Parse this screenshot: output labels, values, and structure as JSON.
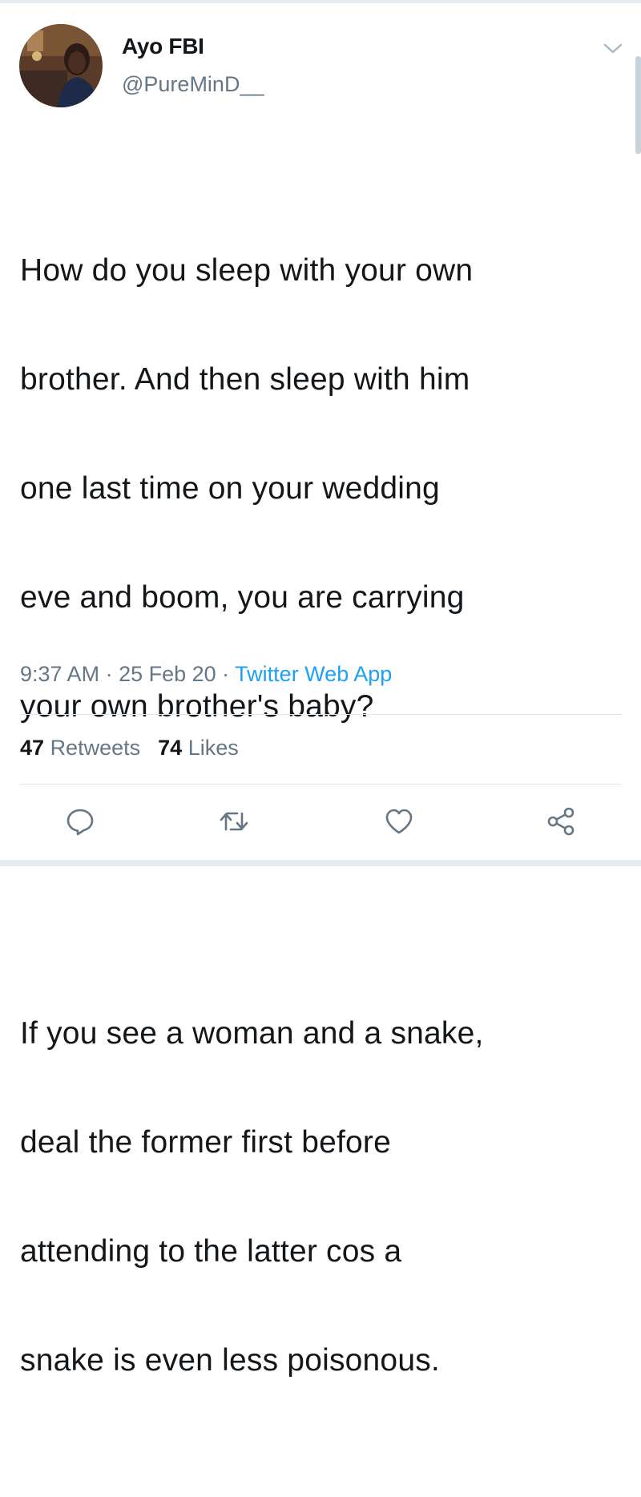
{
  "author": {
    "display_name": "Ayo FBI",
    "handle": "@PureMinD__"
  },
  "tweet": {
    "paragraphs": [
      "How do you sleep with your own brother. And then sleep with him one last time on your wedding eve and boom, you are carrying your own brother's baby?",
      "If you see a woman and a snake, deal the former first before attending to the latter cos a snake is even less poisonous."
    ],
    "lines_p1": [
      "How do you sleep with your own",
      "brother. And then sleep with him",
      "one last time on your wedding",
      "eve and boom, you are carrying",
      "your own brother's baby?"
    ],
    "lines_p2": [
      "If you see a woman and a snake,",
      "deal the former first before",
      "attending to the latter cos a",
      "snake is even less poisonous."
    ]
  },
  "meta": {
    "time": "9:37 AM",
    "separator": " · ",
    "date": "25 Feb 20",
    "app": "Twitter Web App"
  },
  "stats": {
    "retweets_count": "47",
    "retweets_label": "Retweets",
    "likes_count": "74",
    "likes_label": "Likes"
  },
  "actions": {
    "reply_icon": "reply-icon",
    "retweet_icon": "retweet-icon",
    "like_icon": "heart-icon",
    "share_icon": "share-icon"
  },
  "colors": {
    "text_primary": "#14171a",
    "text_secondary": "#657786",
    "link": "#1da1f2",
    "divider": "#e1e8ed"
  }
}
